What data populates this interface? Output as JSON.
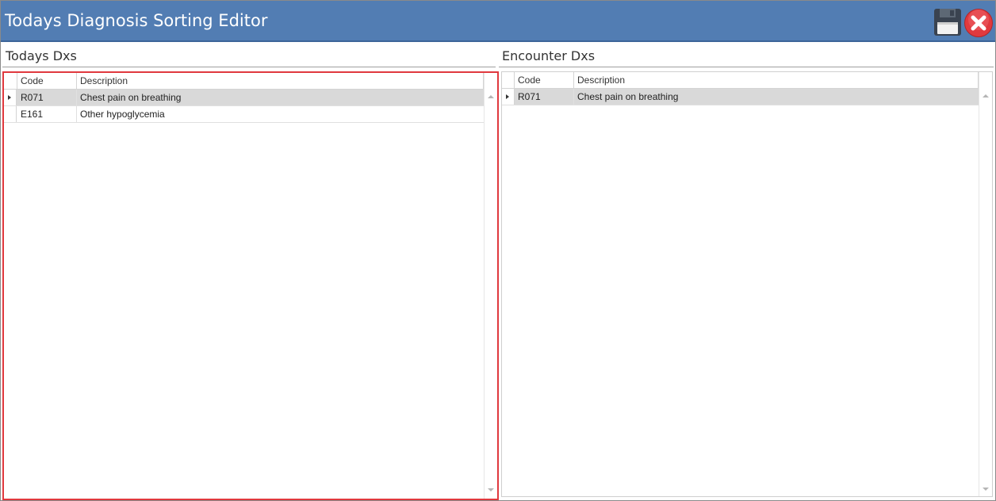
{
  "window": {
    "title": "Todays Diagnosis Sorting Editor"
  },
  "toolbar": {
    "save_icon": "floppy-disk-icon",
    "close_icon": "close-x-icon",
    "colors": {
      "titlebar": "#527db3",
      "close_red": "#e0393e",
      "highlight_border": "#e0393e",
      "selected_row": "#d9d9d9"
    }
  },
  "todays": {
    "title": "Todays Dxs",
    "columns": [
      "Code",
      "Description"
    ],
    "rows": [
      {
        "code": "R071",
        "description": "Chest pain on breathing",
        "selected": true
      },
      {
        "code": "E161",
        "description": "Other hypoglycemia",
        "selected": false
      }
    ]
  },
  "encounter": {
    "title": "Encounter Dxs",
    "columns": [
      "Code",
      "Description"
    ],
    "rows": [
      {
        "code": "R071",
        "description": "Chest pain on breathing",
        "selected": true
      }
    ]
  }
}
